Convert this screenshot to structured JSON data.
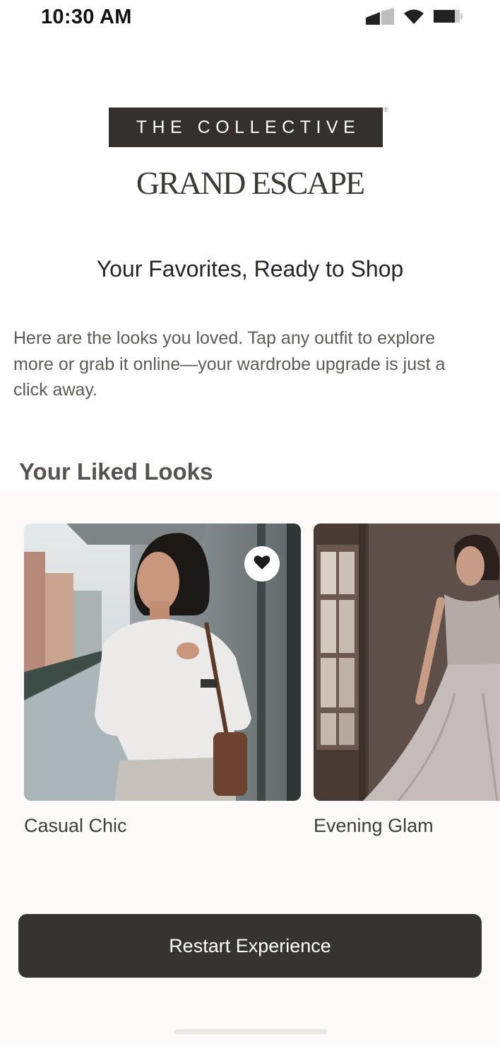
{
  "status_bar": {
    "time": "10:30 AM",
    "icons": [
      "cellular-signal-icon",
      "wifi-icon",
      "battery-icon"
    ]
  },
  "brand": {
    "logo_text": "THE COLLECTIVE",
    "registered_mark": "®",
    "subtitle": "GRAND ESCAPE"
  },
  "page": {
    "title": "Your Favorites, Ready to Shop",
    "intro": "Here are the looks you loved. Tap any outfit to explore more or grab it online—your wardrobe upgrade is just a click away."
  },
  "liked_looks": {
    "section_title": "Your Liked Looks",
    "items": [
      {
        "label": "Casual Chic",
        "liked": true
      },
      {
        "label": "Evening Glam",
        "liked": false
      }
    ]
  },
  "actions": {
    "restart_label": "Restart Experience"
  },
  "colors": {
    "primary_dark": "#363432",
    "section_background": "#fdf9f8",
    "text": "#2f2d2b"
  }
}
